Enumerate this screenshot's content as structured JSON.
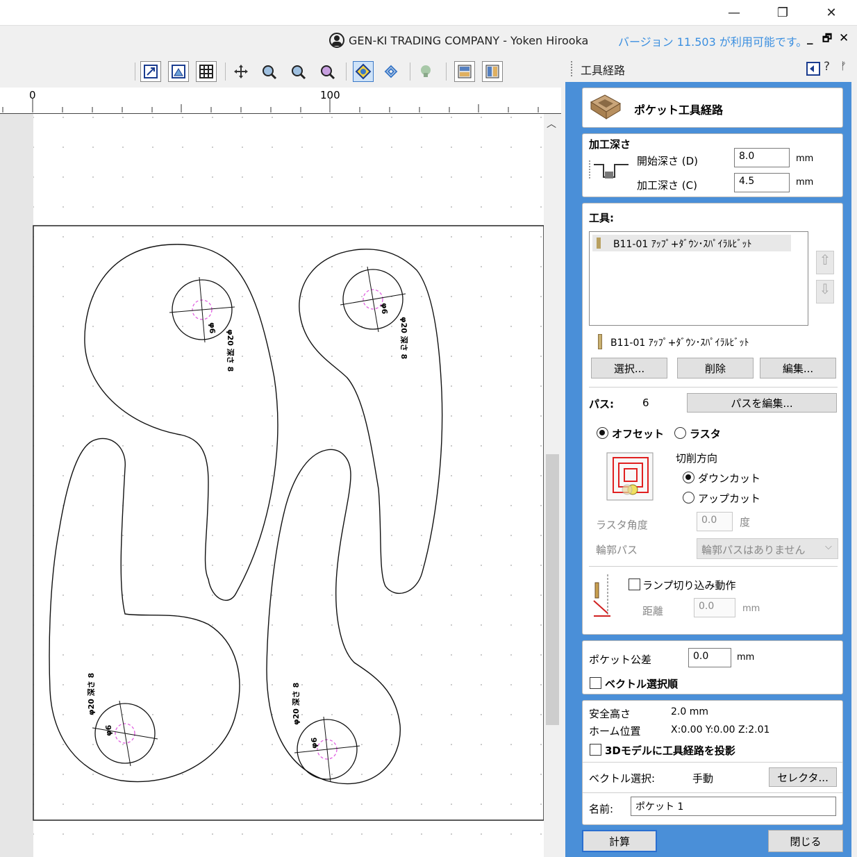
{
  "window": {
    "minimize": "—",
    "restore": "❐",
    "close": "✕"
  },
  "menubar": {
    "account": "GEN-KI TRADING COMPANY - Yoken Hirooka",
    "update_notice": "バージョン 11.503 が利用可能です。",
    "mdi_min": "_",
    "mdi_restore": "🗗",
    "mdi_close": "✕"
  },
  "ruler": {
    "label_0": "0",
    "label_100": "100"
  },
  "drawing": {
    "label_6_a": "φ6",
    "label_20_a": "φ20 深さ 8",
    "label_6_b": "φ6",
    "label_20_b": "φ20 深さ 8",
    "label_6_c": "φ6",
    "label_20_c": "φ20 深さ 8",
    "label_6_d": "φ6",
    "label_20_d": "φ20 深さ 8"
  },
  "panel": {
    "title": "工具経路",
    "header_title": "ポケット工具経路",
    "depth": {
      "heading": "加工深さ",
      "start_label": "開始深さ (D)",
      "start_value": "8.0",
      "start_unit": "mm",
      "cut_label": "加工深さ (C)",
      "cut_value": "4.5",
      "cut_unit": "mm"
    },
    "tool": {
      "heading": "工具:",
      "list_item": "B11-01 ｱｯﾌﾟ+ﾀﾞｳﾝ･ｽﾊﾟｲﾗﾙﾋﾞｯﾄ",
      "selected_tool": "B11-01 ｱｯﾌﾟ+ﾀﾞｳﾝ･ｽﾊﾟｲﾗﾙﾋﾞｯﾄ",
      "select_button": "選択...",
      "delete_button": "削除",
      "edit_button": "編集..."
    },
    "passes": {
      "label": "パス:",
      "value": "6",
      "edit_button": "パスを編集..."
    },
    "strategy": {
      "offset_label": "オフセット",
      "raster_label": "ラスタ",
      "cut_direction_label": "切削方向",
      "climb_label": "ダウンカット",
      "conventional_label": "アップカット",
      "raster_angle_label": "ラスタ角度",
      "raster_angle_value": "0.0",
      "raster_angle_unit": "度",
      "profile_pass_label": "輪郭パス",
      "profile_pass_value": "輪郭パスはありません"
    },
    "ramp": {
      "label": "ランプ切り込み動作",
      "distance_label": "距離",
      "distance_value": "0.0",
      "distance_unit": "mm"
    },
    "tolerance": {
      "label": "ポケット公差",
      "value": "0.0",
      "unit": "mm",
      "vector_order_label": "ベクトル選択順"
    },
    "info": {
      "safe_z_label": "安全高さ",
      "safe_z_value": "2.0 mm",
      "home_label": "ホーム位置",
      "home_value": "X:0.00 Y:0.00 Z:2.01",
      "project_label": "3Dモデルに工具経路を投影",
      "vector_select_label": "ベクトル選択:",
      "vector_select_value": "手動",
      "selector_button": "セレクタ...",
      "name_label": "名前:",
      "name_value": "ポケット 1"
    },
    "calculate_button": "計算",
    "close_button": "閉じる"
  },
  "colors": {
    "accent_blue": "#4a8fd8",
    "update_link": "#3b8fe0",
    "tool_circle": "#e060e0"
  }
}
